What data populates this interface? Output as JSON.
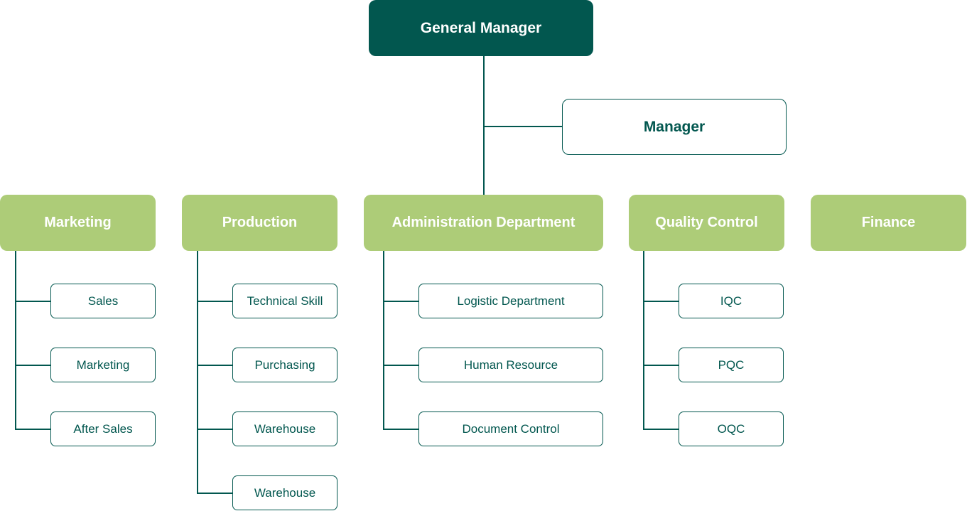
{
  "colors": {
    "top": "#02574f",
    "department": "#adcc78",
    "line": "#02574f"
  },
  "general_manager": "General Manager",
  "manager": "Manager",
  "departments": [
    {
      "label": "Marketing",
      "children": [
        "Sales",
        "Marketing",
        "After Sales"
      ]
    },
    {
      "label": "Production",
      "children": [
        "Technical Skill",
        "Purchasing",
        "Warehouse",
        "Warehouse"
      ]
    },
    {
      "label": "Administration Department",
      "children": [
        "Logistic Department",
        "Human Resource",
        "Document Control"
      ]
    },
    {
      "label": "Quality Control",
      "children": [
        "IQC",
        "PQC",
        "OQC"
      ]
    },
    {
      "label": "Finance",
      "children": []
    }
  ]
}
